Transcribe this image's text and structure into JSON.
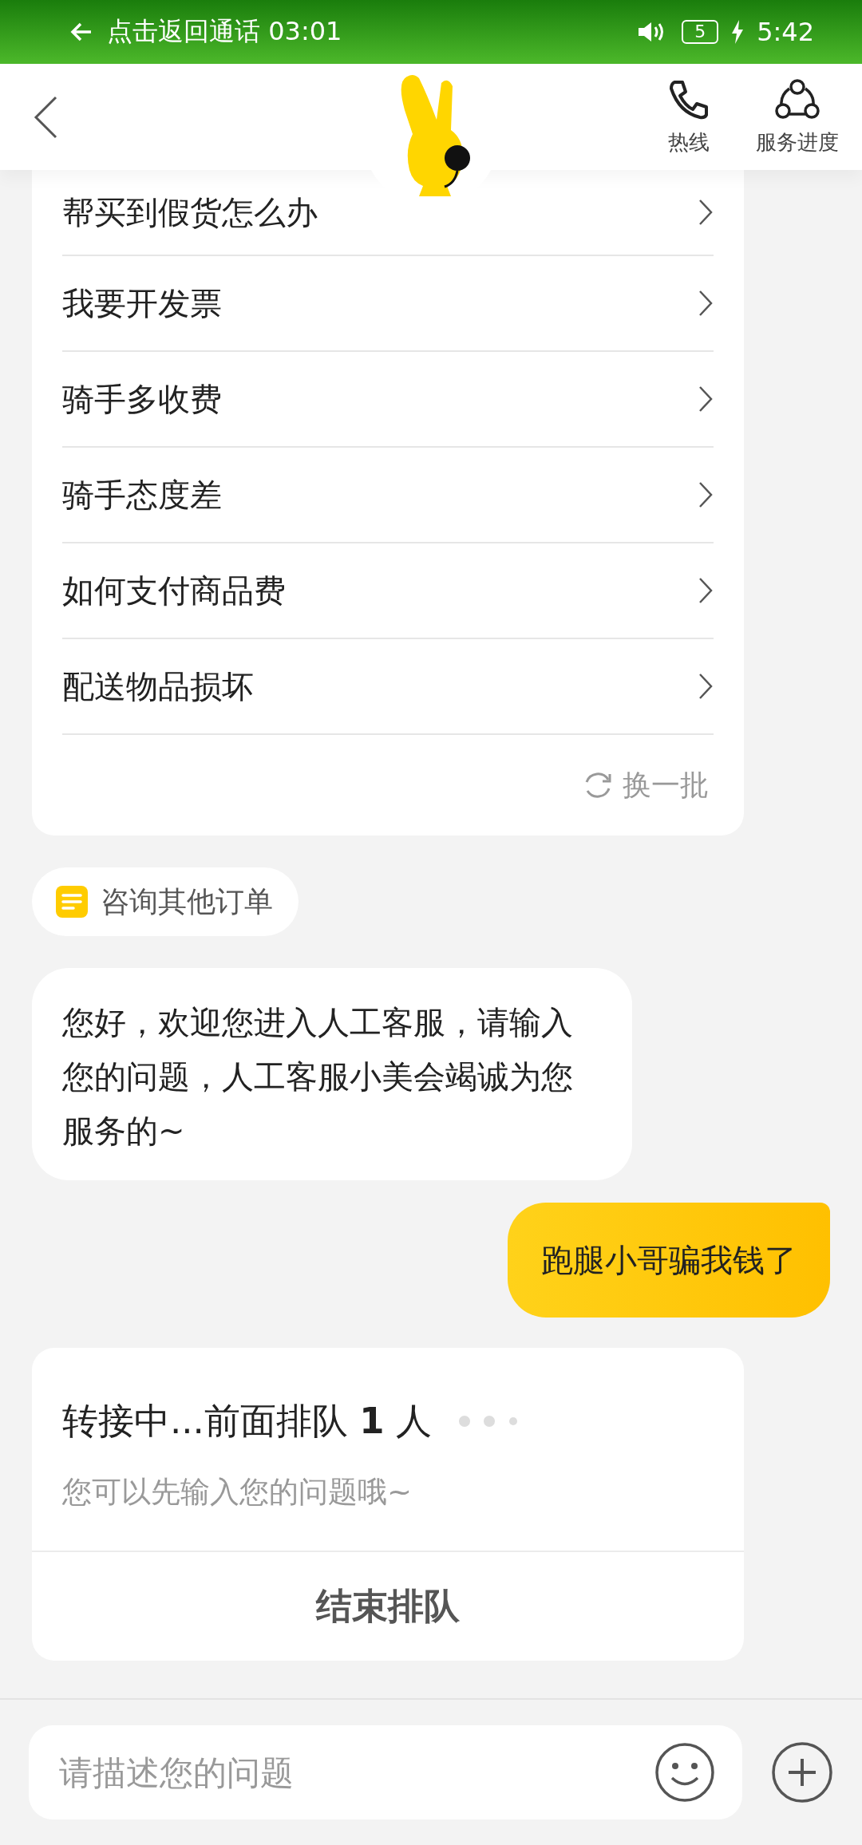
{
  "status_bar": {
    "call_back": "点击返回通话 03:01",
    "battery": "5",
    "time": "5:42"
  },
  "header": {
    "actions": [
      {
        "kind": "phone",
        "label": "热线"
      },
      {
        "kind": "progress",
        "label": "服务进度"
      }
    ]
  },
  "faq": {
    "items": [
      "帮买到假货怎么办",
      "我要开发票",
      "骑手多收费",
      "骑手态度差",
      "如何支付商品费",
      "配送物品损坏"
    ],
    "refresh": "换一批"
  },
  "other_order": "咨询其他订单",
  "messages": [
    {
      "kind": "agent",
      "text": "您好，欢迎您进入人工客服，请输入您的问题，人工客服小美会竭诚为您服务的~"
    },
    {
      "kind": "user",
      "text": "跑腿小哥骗我钱了"
    }
  ],
  "queue": {
    "title": "转接中...前面排队 **1** 人",
    "hint": "您可以先输入您的问题哦~",
    "button": "结束排队"
  },
  "input": {
    "placeholder": "请描述您的问题"
  }
}
